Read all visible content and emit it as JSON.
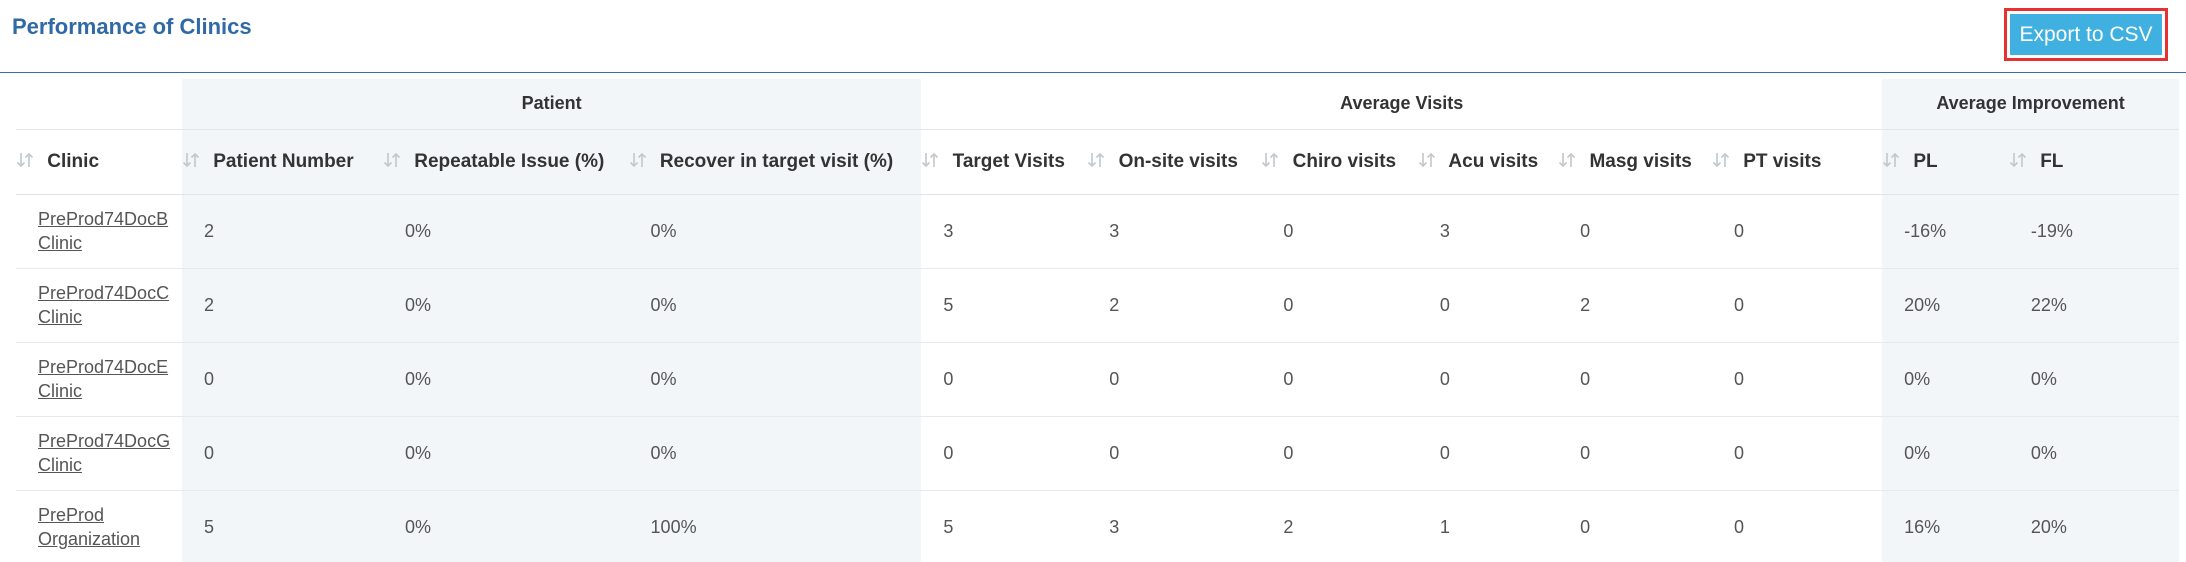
{
  "page": {
    "title": "Performance of Clinics"
  },
  "toolbar": {
    "export_label": "Export to CSV"
  },
  "table": {
    "groups": {
      "patient": "Patient",
      "average_visits": "Average Visits",
      "average_improvement": "Average Improvement"
    },
    "columns": {
      "clinic": "Clinic",
      "patient_number": "Patient Number",
      "repeatable_issue": "Repeatable Issue (%)",
      "recover_target": "Recover in target visit (%)",
      "target_visits": "Target Visits",
      "onsite_visits": "On-site visits",
      "chiro_visits": "Chiro visits",
      "acu_visits": "Acu visits",
      "masg_visits": "Masg visits",
      "pt_visits": "PT visits",
      "pl": "PL",
      "fl": "FL"
    },
    "rows": [
      {
        "clinic": "PreProd74DocB Clinic",
        "patient_number": "2",
        "repeatable_issue": "0%",
        "recover_target": "0%",
        "target_visits": "3",
        "onsite_visits": "3",
        "chiro_visits": "0",
        "acu_visits": "3",
        "masg_visits": "0",
        "pt_visits": "0",
        "pl": "-16%",
        "fl": "-19%"
      },
      {
        "clinic": "PreProd74DocC Clinic",
        "patient_number": "2",
        "repeatable_issue": "0%",
        "recover_target": "0%",
        "target_visits": "5",
        "onsite_visits": "2",
        "chiro_visits": "0",
        "acu_visits": "0",
        "masg_visits": "2",
        "pt_visits": "0",
        "pl": "20%",
        "fl": "22%"
      },
      {
        "clinic": "PreProd74DocE Clinic",
        "patient_number": "0",
        "repeatable_issue": "0%",
        "recover_target": "0%",
        "target_visits": "0",
        "onsite_visits": "0",
        "chiro_visits": "0",
        "acu_visits": "0",
        "masg_visits": "0",
        "pt_visits": "0",
        "pl": "0%",
        "fl": "0%"
      },
      {
        "clinic": "PreProd74DocG Clinic",
        "patient_number": "0",
        "repeatable_issue": "0%",
        "recover_target": "0%",
        "target_visits": "0",
        "onsite_visits": "0",
        "chiro_visits": "0",
        "acu_visits": "0",
        "masg_visits": "0",
        "pt_visits": "0",
        "pl": "0%",
        "fl": "0%"
      },
      {
        "clinic": "PreProd Organization",
        "patient_number": "5",
        "repeatable_issue": "0%",
        "recover_target": "100%",
        "target_visits": "5",
        "onsite_visits": "3",
        "chiro_visits": "2",
        "acu_visits": "1",
        "masg_visits": "0",
        "pt_visits": "0",
        "pl": "16%",
        "fl": "20%"
      }
    ]
  },
  "icons": {
    "sort": "sort-icon"
  },
  "colors": {
    "title": "#2f6aa6",
    "button_bg": "#3fb0e0",
    "button_outline": "#e53131",
    "shade": "#f2f6f9"
  }
}
